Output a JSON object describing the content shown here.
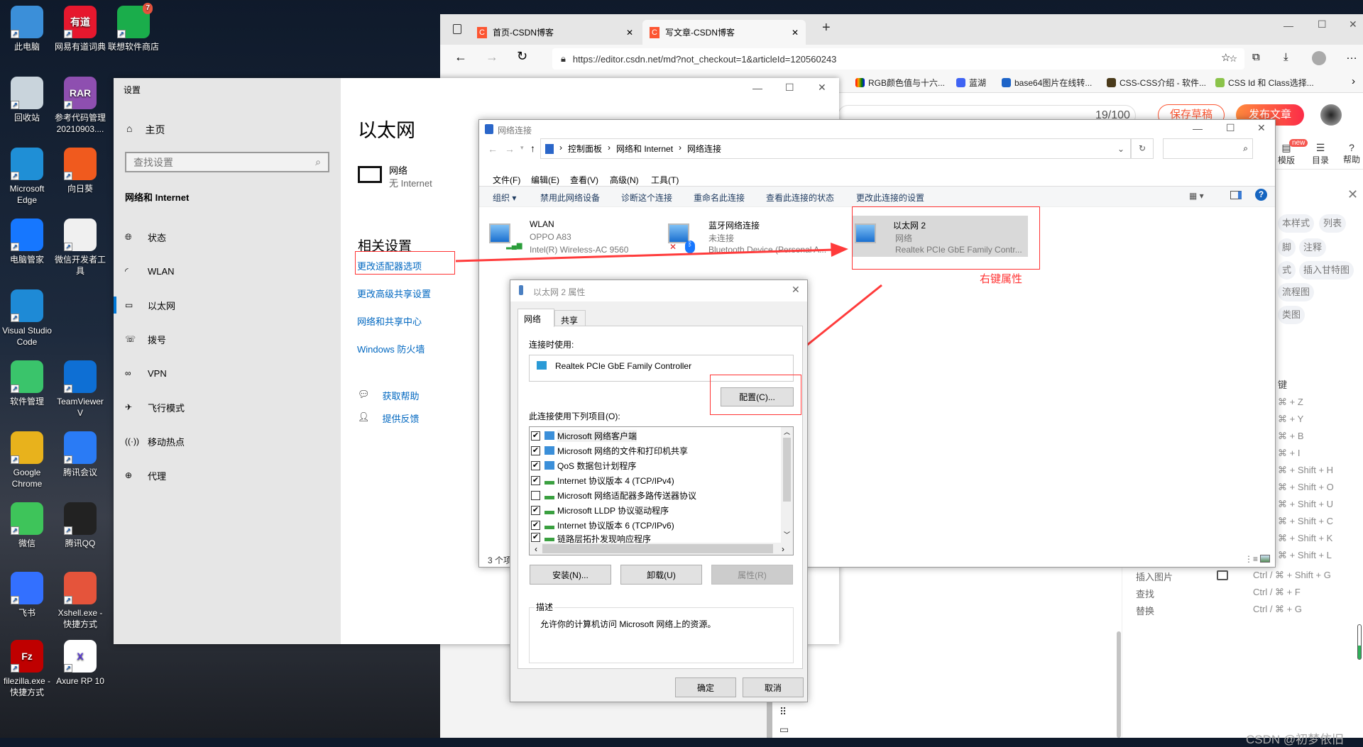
{
  "desktop": {
    "icons": [
      {
        "label": "此电脑",
        "color": "#3b8fd9"
      },
      {
        "label": "网易有道词典",
        "color": "#e6182e",
        "glyph": "有道"
      },
      {
        "label": "联想软件商店",
        "color": "#1aad4b",
        "badge": "7"
      },
      {
        "label": "回收站",
        "color": "#c9d4dc"
      },
      {
        "label": "参考代码管理 20210903....",
        "color": "#8e4fb0",
        "glyph": "RAR"
      },
      {
        "label": "Microsoft Edge",
        "color": "#1f8fd6"
      },
      {
        "label": "向日葵",
        "color": "#f05a1e"
      },
      {
        "label": "电脑管家",
        "color": "#1677ff"
      },
      {
        "label": "微信开发者工具",
        "color": "#f0f0f0"
      },
      {
        "label": "Visual Studio Code",
        "color": "#1e8ad6"
      },
      {
        "label": "软件管理",
        "color": "#3ac46b"
      },
      {
        "label": "TeamViewer V",
        "color": "#0e6fd4"
      },
      {
        "label": "Google Chrome",
        "color": "#e8b21c"
      },
      {
        "label": "腾讯会议",
        "color": "#2a7bf5"
      },
      {
        "label": "微信",
        "color": "#3ec45a"
      },
      {
        "label": "腾讯QQ",
        "color": "#222"
      },
      {
        "label": "飞书",
        "color": "#3370ff"
      },
      {
        "label": "Xshell.exe - 快捷方式",
        "color": "#e5543b"
      },
      {
        "label": "filezilla.exe - 快捷方式",
        "color": "#bf0000",
        "glyph": "Fz"
      },
      {
        "label": "Axure RP 10",
        "color": "#ffffff",
        "glyph": "X"
      }
    ]
  },
  "browser": {
    "tabs": [
      {
        "label": "首页-CSDN博客"
      },
      {
        "label": "写文章-CSDN博客"
      }
    ],
    "url": "https://editor.csdn.net/md?not_checkout=1&articleId=120560243",
    "bookmarks": [
      "RGB颜色值与十六...",
      "蓝湖",
      "base64图片在线转...",
      "CSS-CSS介绍 - 软件...",
      "CSS Id 和 Class选择..."
    ],
    "editor": {
      "word_count": "19/100",
      "save_draft": "保存草稿",
      "publish": "发布文章",
      "tools": [
        {
          "label": "模版",
          "badge": "new"
        },
        {
          "label": "目录"
        },
        {
          "label": "帮助"
        }
      ],
      "tags": [
        "本样式",
        "列表",
        "脚",
        "注释",
        "式",
        "插入甘特图",
        "流程图",
        "类图"
      ],
      "shortcuts_header": "键",
      "shortcut_keys": [
        "⌘ + Z",
        "⌘ + Y",
        "⌘ + B",
        "⌘ + I",
        "⌘ + Shift + H",
        "⌘ + Shift + O",
        "⌘ + Shift + U",
        "⌘ + Shift + C",
        "⌘ + Shift + K",
        "⌘ + Shift + L"
      ],
      "shortcuts": [
        {
          "label": "插入图片",
          "keys": "Ctrl / ⌘ + Shift + G"
        },
        {
          "label": "查找",
          "keys": "Ctrl / ⌘ + F"
        },
        {
          "label": "替换",
          "keys": "Ctrl / ⌘ + G"
        }
      ],
      "watermark": "CSDN @初梦依旧"
    },
    "accent": "#fc5531"
  },
  "settings": {
    "title": "设置",
    "home": "主页",
    "search_placeholder": "查找设置",
    "section": "网络和 Internet",
    "nav": [
      {
        "label": "状态",
        "icon": "globe-status-icon"
      },
      {
        "label": "WLAN",
        "icon": "wifi-icon"
      },
      {
        "label": "以太网",
        "icon": "ethernet-icon",
        "active": true
      },
      {
        "label": "拨号",
        "icon": "dialup-icon"
      },
      {
        "label": "VPN",
        "icon": "vpn-icon"
      },
      {
        "label": "飞行模式",
        "icon": "airplane-icon"
      },
      {
        "label": "移动热点",
        "icon": "hotspot-icon"
      },
      {
        "label": "代理",
        "icon": "globe-icon"
      }
    ],
    "page_title": "以太网",
    "network_name": "网络",
    "network_status": "无 Internet",
    "related_title": "相关设置",
    "links": [
      "更改适配器选项",
      "更改高级共享设置",
      "网络和共享中心",
      "Windows 防火墙"
    ],
    "help_links": [
      "获取帮助",
      "提供反馈"
    ]
  },
  "explorer": {
    "title": "网络连接",
    "breadcrumb": [
      "控制面板",
      "网络和 Internet",
      "网络连接"
    ],
    "menu": [
      "文件(F)",
      "编辑(E)",
      "查看(V)",
      "高级(N)",
      "工具(T)"
    ],
    "commands": [
      "组织 ▾",
      "禁用此网络设备",
      "诊断这个连接",
      "重命名此连接",
      "查看此连接的状态",
      "更改此连接的设置"
    ],
    "items": [
      {
        "name": "WLAN",
        "status": "OPPO A83",
        "device": "Intel(R) Wireless-AC 9560"
      },
      {
        "name": "蓝牙网络连接",
        "status": "未连接",
        "device": "Bluetooth Device (Personal A..."
      },
      {
        "name": "以太网 2",
        "status": "网络",
        "device": "Realtek PCIe GbE Family Contr...",
        "selected": true
      }
    ],
    "status_text": "3 个项"
  },
  "dialog": {
    "title": "以太网 2 属性",
    "tabs": [
      "网络",
      "共享"
    ],
    "connect_using_label": "连接时使用:",
    "adapter": "Realtek PCIe GbE Family Controller",
    "configure": "配置(C)...",
    "items_label": "此连接使用下列项目(O):",
    "items": [
      {
        "label": "Microsoft 网络客户端",
        "checked": true
      },
      {
        "label": "Microsoft 网络的文件和打印机共享",
        "checked": true
      },
      {
        "label": "QoS 数据包计划程序",
        "checked": true
      },
      {
        "label": "Internet 协议版本 4 (TCP/IPv4)",
        "checked": true
      },
      {
        "label": "Microsoft 网络适配器多路传送器协议",
        "checked": false
      },
      {
        "label": "Microsoft LLDP 协议驱动程序",
        "checked": true
      },
      {
        "label": "Internet 协议版本 6 (TCP/IPv6)",
        "checked": true
      },
      {
        "label": "链路层拓扑发现响应程序",
        "checked": true
      }
    ],
    "install": "安装(N)...",
    "uninstall": "卸载(U)",
    "properties": "属性(R)",
    "description_label": "描述",
    "description": "允许你的计算机访问 Microsoft 网络上的资源。",
    "ok": "确定",
    "cancel": "取消"
  },
  "annotation": {
    "label": "右键属性",
    "color": "#ff3333"
  }
}
